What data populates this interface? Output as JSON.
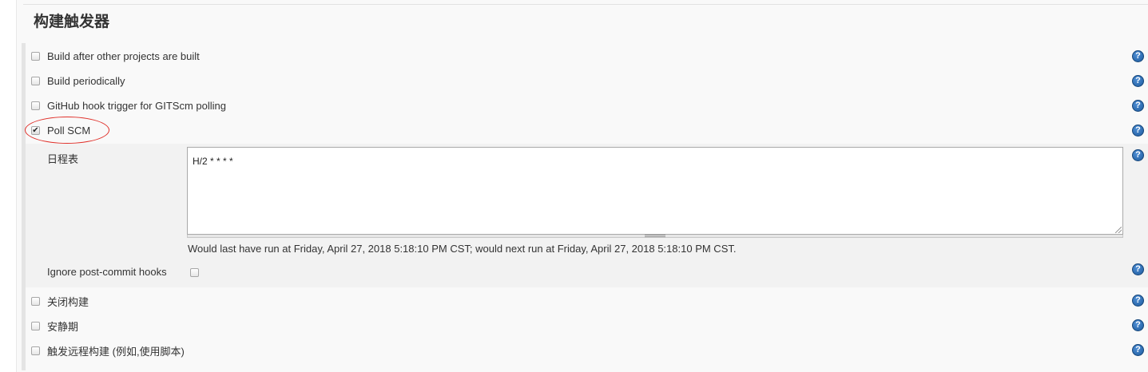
{
  "section": {
    "title": "构建触发器"
  },
  "triggers": {
    "build_after": {
      "label": "Build after other projects are built",
      "checked": false
    },
    "build_periodically": {
      "label": "Build periodically",
      "checked": false
    },
    "github_hook": {
      "label": "GitHub hook trigger for GITScm polling",
      "checked": false
    },
    "poll_scm": {
      "label": "Poll SCM",
      "checked": true,
      "check_mark": "✔"
    },
    "disable_build": {
      "label": "关闭构建",
      "checked": false
    },
    "quiet_period": {
      "label": "安静期",
      "checked": false
    },
    "remote_trigger": {
      "label": "触发远程构建 (例如,使用脚本)",
      "checked": false
    }
  },
  "poll_scm_options": {
    "schedule_label": "日程表",
    "schedule_value": "H/2 * * * *",
    "run_info": "Would last have run at Friday, April 27, 2018 5:18:10 PM CST; would next run at Friday, April 27, 2018 5:18:10 PM CST.",
    "ignore_hooks_label": "Ignore post-commit hooks",
    "ignore_hooks_checked": false
  },
  "help": {
    "glyph": "?",
    "icon": "help-icon",
    "color": "#1d5a9c"
  },
  "annotation": {
    "color": "#e0302a"
  }
}
